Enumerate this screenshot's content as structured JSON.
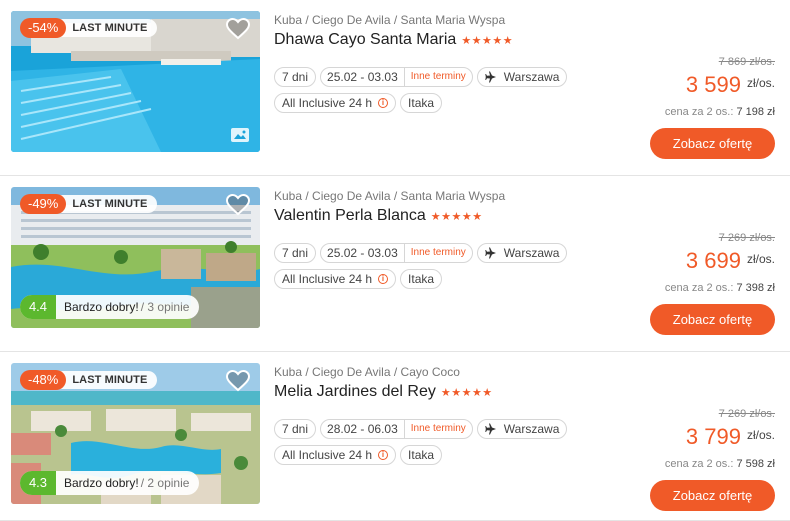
{
  "colors": {
    "accent": "#f05a28",
    "rating": "#5cb82e"
  },
  "offers": [
    {
      "discount": "-54%",
      "tag": "LAST MINUTE",
      "rating": null,
      "breadcrumb": "Kuba / Ciego De Avila / Santa Maria Wyspa",
      "name": "Dhawa Cayo Santa Maria",
      "stars": "★★★★★",
      "duration": "7 dni",
      "dates": "25.02 - 03.03",
      "other_dates": "Inne terminy",
      "departure": "Warszawa",
      "board": "All Inclusive 24 h",
      "operator": "Itaka",
      "old_price": "7 869 zł/os.",
      "price": "3 599",
      "price_unit": "zł/os.",
      "price_for_two_label": "cena za 2 os.:",
      "price_for_two": "7 198 zł",
      "cta": "Zobacz ofertę"
    },
    {
      "discount": "-49%",
      "tag": "LAST MINUTE",
      "rating": {
        "score": "4.4",
        "label": "Bardzo dobry!",
        "opinions": "/ 3 opinie"
      },
      "breadcrumb": "Kuba / Ciego De Avila / Santa Maria Wyspa",
      "name": "Valentin Perla Blanca",
      "stars": "★★★★★",
      "duration": "7 dni",
      "dates": "25.02 - 03.03",
      "other_dates": "Inne terminy",
      "departure": "Warszawa",
      "board": "All Inclusive 24 h",
      "operator": "Itaka",
      "old_price": "7 269 zł/os.",
      "price": "3 699",
      "price_unit": "zł/os.",
      "price_for_two_label": "cena za 2 os.:",
      "price_for_two": "7 398 zł",
      "cta": "Zobacz ofertę"
    },
    {
      "discount": "-48%",
      "tag": "LAST MINUTE",
      "rating": {
        "score": "4.3",
        "label": "Bardzo dobry!",
        "opinions": "/ 2 opinie"
      },
      "breadcrumb": "Kuba / Ciego De Avila / Cayo Coco",
      "name": "Melia Jardines del Rey",
      "stars": "★★★★★",
      "duration": "7 dni",
      "dates": "28.02 - 06.03",
      "other_dates": "Inne terminy",
      "departure": "Warszawa",
      "board": "All Inclusive 24 h",
      "operator": "Itaka",
      "old_price": "7 269 zł/os.",
      "price": "3 799",
      "price_unit": "zł/os.",
      "price_for_two_label": "cena za 2 os.:",
      "price_for_two": "7 598 zł",
      "cta": "Zobacz ofertę"
    }
  ]
}
